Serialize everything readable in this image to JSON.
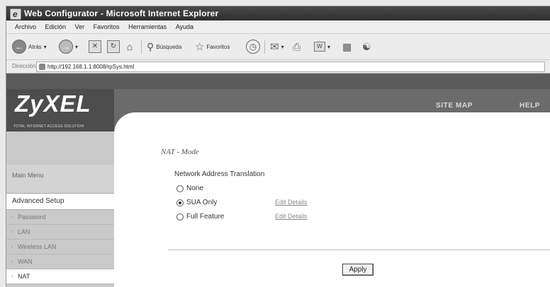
{
  "window": {
    "title": "Web Configurator - Microsoft Internet Explorer"
  },
  "menubar": {
    "items": [
      "Archivo",
      "Edición",
      "Ver",
      "Favoritos",
      "Herramientas",
      "Ayuda"
    ]
  },
  "toolbar": {
    "back_label": "Atrás",
    "search_label": "Búsqueda",
    "favorites_label": "Favoritos"
  },
  "address": {
    "label": "Dirección",
    "url": "http://192.168.1.1:8008/rpSys.html"
  },
  "header": {
    "logo": "ZyXEL",
    "tagline": "TOTAL INTERNET ACCESS SOLUTION",
    "site_map": "SITE MAP",
    "help": "HELP"
  },
  "sidebar": {
    "main_menu": "Main Menu",
    "advanced_setup": "Advanced Setup",
    "items": [
      {
        "label": "Password"
      },
      {
        "label": "LAN"
      },
      {
        "label": "Wireless LAN"
      },
      {
        "label": "WAN"
      },
      {
        "label": "NAT"
      }
    ]
  },
  "main": {
    "title": "NAT - Mode",
    "section_title": "Network Address Translation",
    "options": [
      {
        "label": "None",
        "selected": false
      },
      {
        "label": "SUA Only",
        "selected": true,
        "edit": "Edit Details"
      },
      {
        "label": "Full Feature",
        "selected": false,
        "edit": "Edit Details"
      }
    ],
    "apply_label": "Apply"
  }
}
